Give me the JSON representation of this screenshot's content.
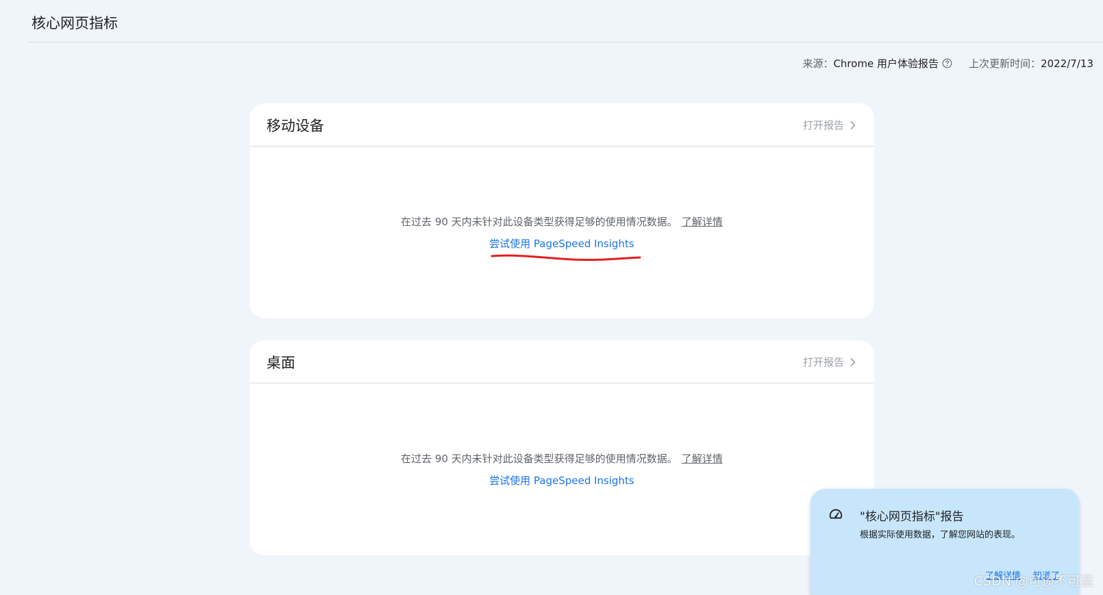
{
  "header": {
    "title": "核心网页指标"
  },
  "meta": {
    "source_label": "来源：",
    "source_value": "Chrome 用户体验报告",
    "updated_label": "上次更新时间：",
    "updated_value": "2022/7/13"
  },
  "cards": [
    {
      "title": "移动设备",
      "open_report": "打开报告",
      "message": "在过去 90 天内未针对此设备类型获得足够的使用情况数据。",
      "learn_more": "了解详情",
      "psi_link": "尝试使用 PageSpeed Insights"
    },
    {
      "title": "桌面",
      "open_report": "打开报告",
      "message": "在过去 90 天内未针对此设备类型获得足够的使用情况数据。",
      "learn_more": "了解详情",
      "psi_link": "尝试使用 PageSpeed Insights"
    }
  ],
  "toast": {
    "title": "\"核心网页指标\"报告",
    "description": "根据实际使用数据，了解您网站的表现。",
    "learn_more": "了解详情",
    "dismiss": "知道了"
  },
  "watermark": "CSDN @可谈不可滥",
  "colors": {
    "background": "#f0f4fb",
    "link": "#1a73e8",
    "toast_bg": "#c7e6fb",
    "annotation": "#e0201e"
  }
}
